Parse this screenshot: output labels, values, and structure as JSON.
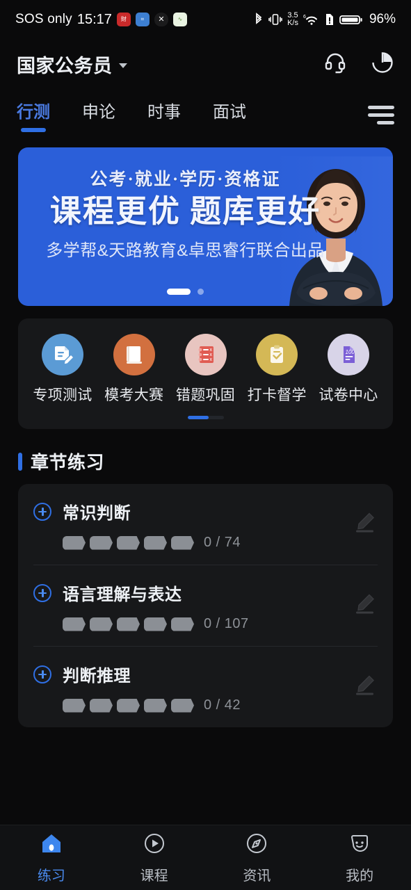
{
  "statusbar": {
    "carrier": "SOS only",
    "time": "15:17",
    "app_icons": [
      "red-app-icon",
      "blue-app-icon",
      "shield-app-icon",
      "green-app-icon"
    ],
    "net_rate_value": "3.5",
    "net_rate_unit": "K/s",
    "battery_percent": "96%",
    "icons": [
      "bluetooth-icon",
      "vibrate-icon",
      "wifi-icon",
      "sim-alert-icon",
      "battery-icon"
    ]
  },
  "header": {
    "title": "国家公务员",
    "dropdown": "chevron-down-icon",
    "service_icon": "headset-icon",
    "stats_icon": "pie-chart-icon"
  },
  "tabs": {
    "items": [
      {
        "label": "行测",
        "active": true
      },
      {
        "label": "申论",
        "active": false
      },
      {
        "label": "时事",
        "active": false
      },
      {
        "label": "面试",
        "active": false
      }
    ],
    "menu_icon": "list-menu-icon"
  },
  "banner": {
    "line1": "公考·就业·学历·资格证",
    "line2": "课程更优 题库更好",
    "line3": "多学帮&天路教育&卓思睿行联合出品",
    "bg_color": "#2b5fd9",
    "dots": 2,
    "active_dot": 0
  },
  "quick_actions": {
    "items": [
      {
        "label": "专项测试",
        "icon": "document-pencil-icon",
        "color": "#5b9bd5"
      },
      {
        "label": "模考大赛",
        "icon": "book-icon",
        "color": "#d2703f"
      },
      {
        "label": "错题巩固",
        "icon": "wrong-question-notebook-icon",
        "color": "#e8c5c0"
      },
      {
        "label": "打卡督学",
        "icon": "clipboard-check-icon",
        "color": "#d4b856"
      },
      {
        "label": "试卷中心",
        "icon": "exam-paper-100-icon",
        "color": "#d8d4e8"
      }
    ]
  },
  "section": {
    "title": "章节练习",
    "accent_color": "#2f6fe4"
  },
  "chapters": {
    "items": [
      {
        "name": "常识判断",
        "progress": "0 / 74",
        "segments": 5,
        "expand_icon": "plus-circle-icon",
        "edit_icon": "pencil-icon"
      },
      {
        "name": "语言理解与表达",
        "progress": "0 / 107",
        "segments": 5,
        "expand_icon": "plus-circle-icon",
        "edit_icon": "pencil-icon"
      },
      {
        "name": "判断推理",
        "progress": "0 / 42",
        "segments": 5,
        "expand_icon": "plus-circle-icon",
        "edit_icon": "pencil-icon"
      }
    ]
  },
  "bottom_nav": {
    "items": [
      {
        "label": "练习",
        "icon": "home-icon",
        "active": true
      },
      {
        "label": "课程",
        "icon": "play-circle-icon",
        "active": false
      },
      {
        "label": "资讯",
        "icon": "compass-icon",
        "active": false
      },
      {
        "label": "我的",
        "icon": "profile-smile-icon",
        "active": false
      }
    ],
    "active_color": "#4a8bf0"
  }
}
